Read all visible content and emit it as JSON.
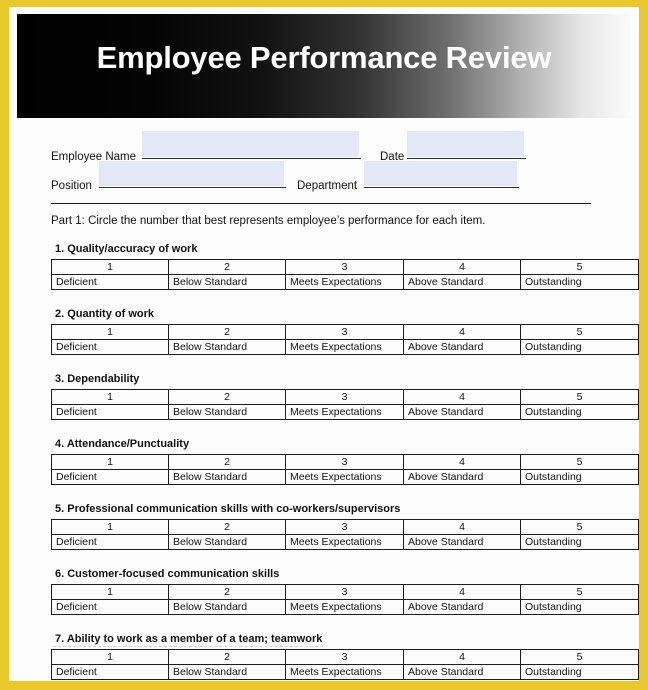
{
  "document": {
    "title": "Employee Performance Review",
    "frame_color": "#e8c92c",
    "banner_gradient_from": "#000000",
    "banner_gradient_to": "#fbfbfb",
    "field_fill_color": "#e3e8f6"
  },
  "identity": {
    "employee_name_label": "Employee Name",
    "employee_name_value": "",
    "date_label": "Date",
    "date_value": "",
    "position_label": "Position",
    "position_value": "",
    "department_label": "Department",
    "department_value": ""
  },
  "instructions": {
    "part_label": "Part 1:",
    "text": "Part 1: Circle the number that best represents employee’s performance for each item."
  },
  "scale": {
    "numbers": [
      "1",
      "2",
      "3",
      "4",
      "5"
    ],
    "labels": [
      "Deficient",
      "Below Standard",
      "Meets Expectations",
      "Above Standard",
      "Outstanding"
    ]
  },
  "items": [
    {
      "title": "1. Quality/accuracy of work"
    },
    {
      "title": "2. Quantity of work"
    },
    {
      "title": "3. Dependability"
    },
    {
      "title": "4. Attendance/Punctuality"
    },
    {
      "title": "5. Professional communication skills with co-workers/supervisors"
    },
    {
      "title": "6. Customer-focused communication skills"
    },
    {
      "title": "7. Ability to work as a member of a team; teamwork"
    }
  ]
}
